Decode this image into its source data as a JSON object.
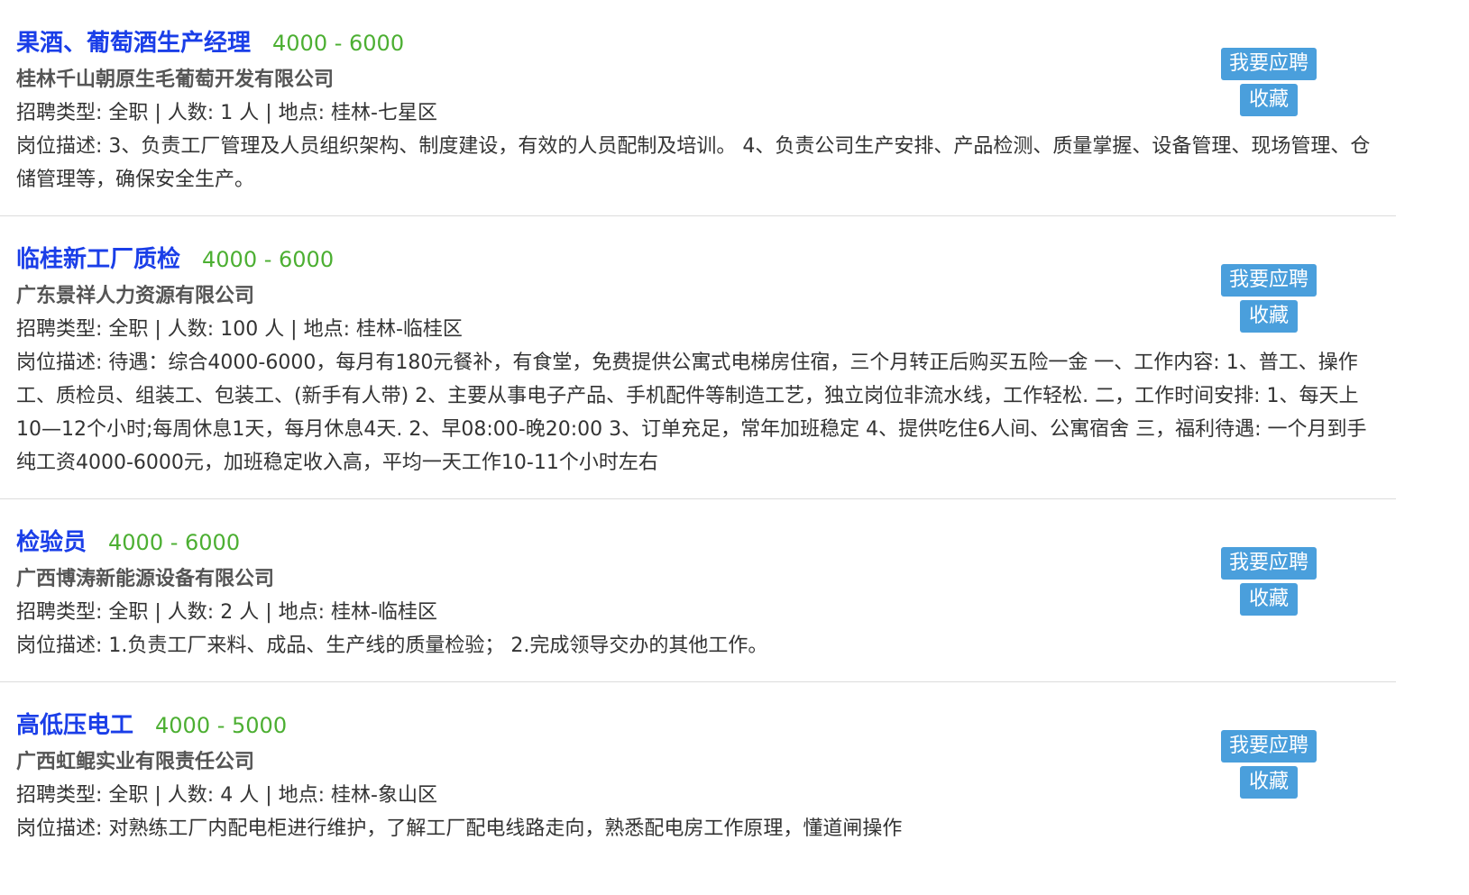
{
  "jobs": [
    {
      "title": "果酒、葡萄酒生产经理",
      "salary": "4000 - 6000",
      "company": "桂林千山朝原生毛葡萄开发有限公司",
      "meta": "招聘类型:   全职 | 人数:  1 人 | 地点:   桂林-七星区",
      "desc": "岗位描述:   3、负责工厂管理及人员组织架构、制度建设，有效的人员配制及培训。 4、负责公司生产安排、产品检测、质量掌握、设备管理、现场管理、仓储管理等，确保安全生产。",
      "apply_label": "我要应聘",
      "fav_label": "收藏"
    },
    {
      "title": "临桂新工厂质检",
      "salary": "4000 - 6000",
      "company": "广东景祥人力资源有限公司",
      "meta": "招聘类型:   全职 | 人数:  100 人 | 地点:   桂林-临桂区",
      "desc": "岗位描述:   待遇：综合4000-6000，每月有180元餐补，有食堂，免费提供公寓式电梯房住宿，三个月转正后购买五险一金 一、工作内容: 1、普工、操作工、质检员、组装工、包装工、(新手有人带) 2、主要从事电子产品、手机配件等制造工艺，独立岗位非流水线，工作轻松. 二，工作时间安排: 1、每天上10—12个小时;每周休息1天，每月休息4天. 2、早08:00-晚20:00 3、订单充足，常年加班稳定 4、提供吃住6人间、公寓宿舍 三，福利待遇: 一个月到手纯工资4000-6000元，加班稳定收入高，平均一天工作10-11个小时左右",
      "apply_label": "我要应聘",
      "fav_label": "收藏"
    },
    {
      "title": "检验员",
      "salary": "4000 - 6000",
      "company": "广西博涛新能源设备有限公司",
      "meta": "招聘类型:   全职 | 人数:  2 人 | 地点:   桂林-临桂区",
      "desc": "岗位描述:   1.负责工厂来料、成品、生产线的质量检验；  2.完成领导交办的其他工作。",
      "apply_label": "我要应聘",
      "fav_label": "收藏"
    },
    {
      "title": "高低压电工",
      "salary": "4000 - 5000",
      "company": "广西虹鲲实业有限责任公司",
      "meta": "招聘类型:   全职 | 人数:  4 人 | 地点:   桂林-象山区",
      "desc": "岗位描述:   对熟练工厂内配电柜进行维护，了解工厂配电线路走向，熟悉配电房工作原理，懂道闸操作",
      "apply_label": "我要应聘",
      "fav_label": "收藏"
    }
  ]
}
